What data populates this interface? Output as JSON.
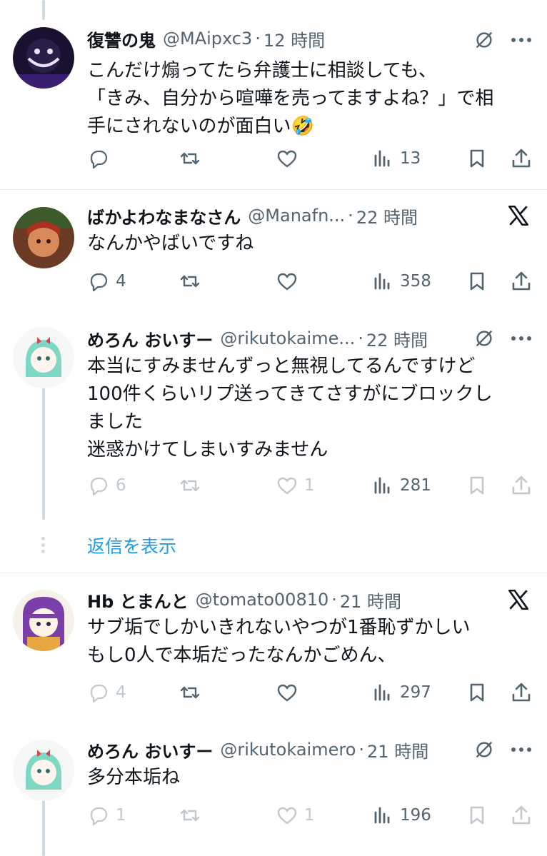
{
  "tweets": [
    {
      "name": "復讐の鬼",
      "handle": "@MAipxc3",
      "sep": "·",
      "time": "12 時間",
      "text": "こんだけ煽ってたら弁護士に相談しても、\n「きみ、自分から喧嘩を売ってますよね？」で相\n手にされないのが面白い🤣",
      "replies": "",
      "retweets": "",
      "likes": "",
      "views": "13",
      "corner_icon": "grok-icon",
      "dim": false
    },
    {
      "name": "ばかよわなまなさん",
      "handle": "@Manafn...",
      "sep": "·",
      "time": "22 時間",
      "text": "なんかやばいですね",
      "replies": "4",
      "retweets": "",
      "likes": "",
      "views": "358",
      "corner_icon": "x-logo-icon",
      "dim": false
    },
    {
      "name": "めろん おいすー",
      "handle": "@rikutokaime...",
      "sep": "·",
      "time": "22 時間",
      "text": "本当にすみませんずっと無視してるんですけど\n100件くらいリプ送ってきてさすがにブロックし\nました\n迷惑かけてしまいすみません",
      "replies": "6",
      "retweets": "",
      "likes": "1",
      "views": "281",
      "corner_icon": "grok-icon",
      "dim": true
    },
    {
      "name": "Hb とまんと",
      "handle": "@tomato00810",
      "sep": "·",
      "time": "21 時間",
      "text": "サブ垢でしかいきれないやつが1番恥ずかしい\nもし0人で本垢だったなんかごめん、",
      "replies": "4",
      "retweets": "",
      "likes": "",
      "views": "297",
      "corner_icon": "x-logo-icon",
      "dim": false
    },
    {
      "name": "めろん おいすー",
      "handle": "@rikutokaimero",
      "sep": "·",
      "time": "21 時間",
      "text": "多分本垢ね",
      "replies": "1",
      "retweets": "",
      "likes": "1",
      "views": "196",
      "corner_icon": "grok-icon",
      "dim": true
    }
  ],
  "show_replies_label": "返信を表示",
  "colors": {
    "text": "#0f1419",
    "secondary": "#536471",
    "accent": "#1d9bf0",
    "line": "#cfd9de"
  }
}
